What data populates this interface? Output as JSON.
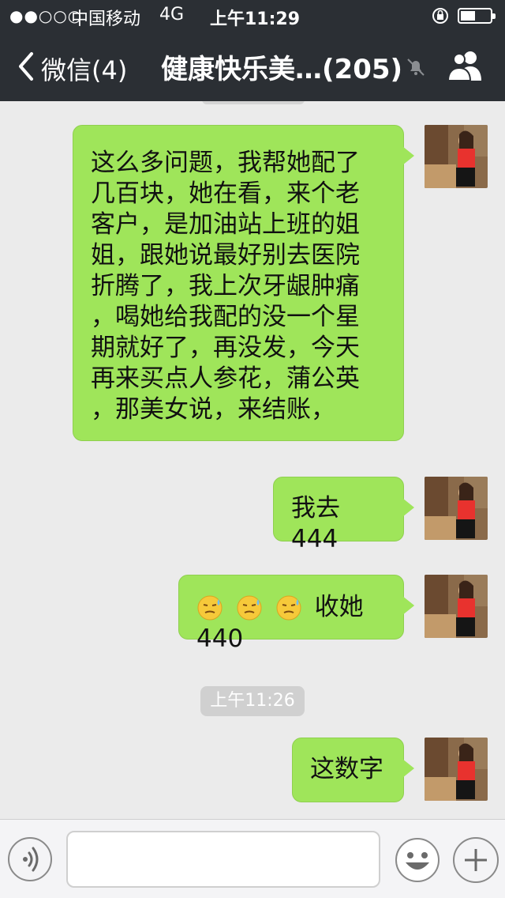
{
  "status_bar": {
    "signal": "●●○○○",
    "carrier": "中国移动",
    "network": "4G",
    "time": "上午11:29"
  },
  "nav": {
    "back_label": "微信(4)",
    "title": "健康快乐美…(205)"
  },
  "messages": [
    {
      "side": "right",
      "text": "这么多问题，我帮她配了\n几百块，她在看，来个老\n客户，是加油站上班的姐\n姐，跟她说最好别去医院\n折腾了，我上次牙龈肿痛\n，喝她给我配的没一个星\n期就好了，再没发，今天\n再来买点人参花，蒲公英\n，那美女说，来结账，"
    },
    {
      "side": "right",
      "text": "我去444"
    },
    {
      "side": "right",
      "emojis": [
        "sweat-smile",
        "sweat-smile",
        "sweat-smile"
      ],
      "text": "收她440"
    },
    {
      "side": "right",
      "text": "这数字"
    }
  ],
  "timestamp": "上午11:26",
  "input": {
    "value": ""
  },
  "colors": {
    "nav_bg": "#2b2f34",
    "bubble_green": "#9fe55a",
    "chat_bg": "#ebebeb"
  }
}
